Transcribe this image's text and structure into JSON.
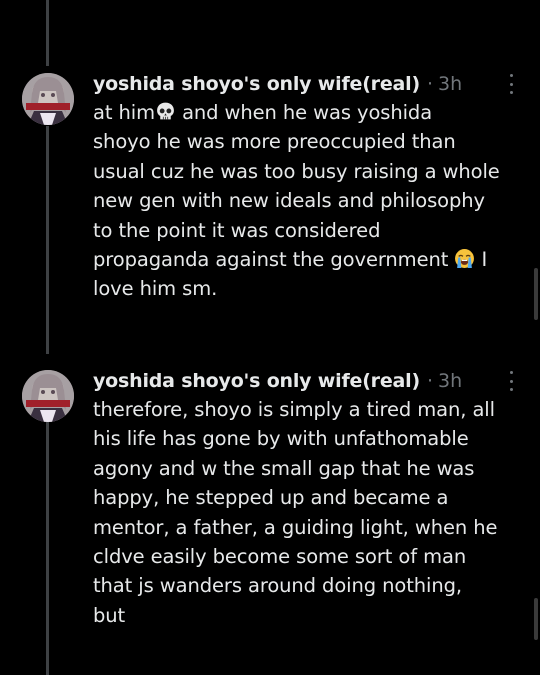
{
  "tweets": [
    {
      "author": "yoshida shoyo's only wife(real)",
      "separator": "·",
      "time": "3h",
      "lines": [
        {
          "before": "at him",
          "emoji": "skull-emoji",
          "after": " and when he was yoshida"
        },
        {
          "before": "shoyo he was more preoccupied than"
        },
        {
          "before": "usual cuz he was too busy raising a whole"
        },
        {
          "before": "new gen with new ideals and philosophy"
        },
        {
          "before": "to the point it was considered"
        },
        {
          "before": "propaganda against the government ",
          "emoji": "loudly-crying-face-emoji",
          "after": " I"
        },
        {
          "before": "love him sm."
        }
      ]
    },
    {
      "author": "yoshida shoyo's only wife(real)",
      "separator": "·",
      "time": "3h",
      "lines": [
        {
          "before": "therefore, shoyo is simply a tired man, all"
        },
        {
          "before": "his life has gone by with unfathomable"
        },
        {
          "before": "agony and w the small gap that he was"
        },
        {
          "before": "happy, he stepped up and became a"
        },
        {
          "before": "mentor, a father, a guiding light, when he"
        },
        {
          "before": "cldve easily become some sort of man"
        },
        {
          "before": "that js wanders around doing nothing,"
        },
        {
          "before": "but"
        }
      ]
    }
  ],
  "icons": {
    "more": "more-options-icon",
    "avatar": "avatar"
  },
  "colors": {
    "background": "#000000",
    "text": "#e7e9ea",
    "muted": "#71767b",
    "thread_line": "#3e4144"
  }
}
